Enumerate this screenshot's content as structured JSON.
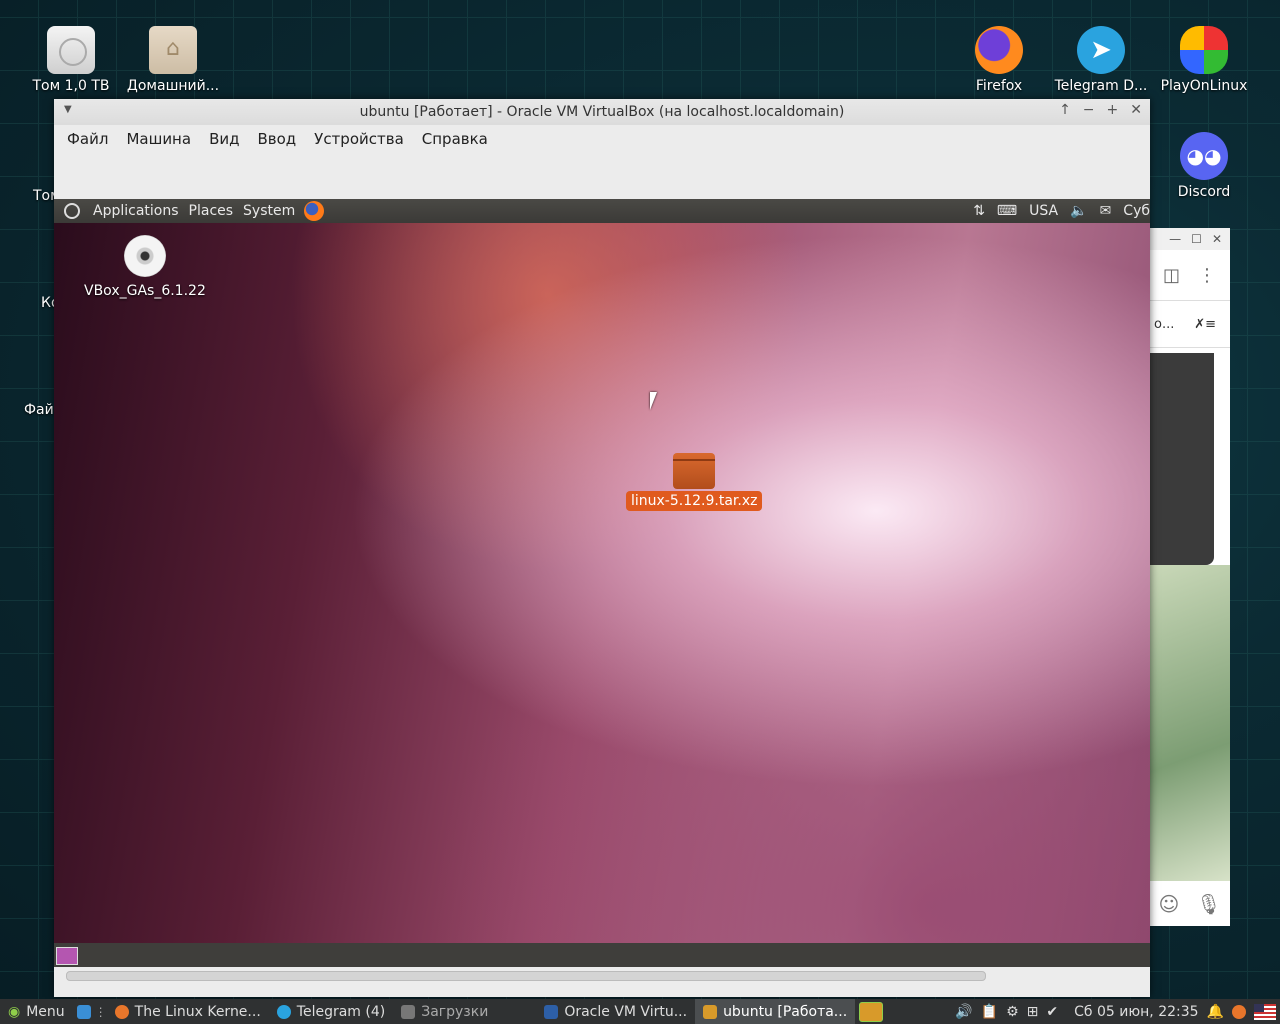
{
  "desktop": {
    "icons_left": [
      {
        "label": "Том 1,0 ТВ",
        "icon": "hard-drive-icon"
      },
      {
        "label": "Домашний...",
        "icon": "home-folder-icon"
      }
    ],
    "icons_right": [
      {
        "label": "Firefox",
        "icon": "firefox-icon"
      },
      {
        "label": "Telegram D...",
        "icon": "telegram-icon"
      },
      {
        "label": "PlayOnLinux",
        "icon": "playonlinux-icon"
      },
      {
        "label": "Discord",
        "icon": "discord-icon"
      }
    ],
    "clipped_labels": [
      "Том",
      "Ко",
      "Фай"
    ]
  },
  "background_window": {
    "clipped_text": "о..."
  },
  "vbox_window": {
    "title": "ubuntu [Работает] - Oracle VM VirtualBox (на localhost.localdomain)",
    "menu": [
      "Файл",
      "Машина",
      "Вид",
      "Ввод",
      "Устройства",
      "Справка"
    ]
  },
  "guest": {
    "panel": {
      "menus": [
        "Applications",
        "Places",
        "System"
      ],
      "keyboard_layout": "USA",
      "clock_clipped": "Суб"
    },
    "icons": [
      {
        "label": "VBox_GAs_6.1.22",
        "icon": "cdrom-icon"
      },
      {
        "label": "linux-5.12.9.tar.xz",
        "icon": "archive-package-icon",
        "selected": true
      }
    ]
  },
  "taskbar": {
    "menu_label": "Menu",
    "items": [
      {
        "label": "The Linux Kerne...",
        "icon": "firefox-icon",
        "active": false
      },
      {
        "label": "Telegram (4)",
        "icon": "telegram-icon",
        "active": false
      },
      {
        "label": "Загрузки",
        "icon": "folder-icon",
        "active": false
      },
      {
        "label": "Oracle VM Virtu...",
        "icon": "virtualbox-icon",
        "active": false
      },
      {
        "label": "ubuntu [Работа...",
        "icon": "virtualbox-vm-icon",
        "active": true
      }
    ],
    "clock": "Сб 05 июн, 22:35"
  },
  "colors": {
    "accent_selection": "#e05a1e",
    "taskbar_bg": "#2f3132"
  }
}
